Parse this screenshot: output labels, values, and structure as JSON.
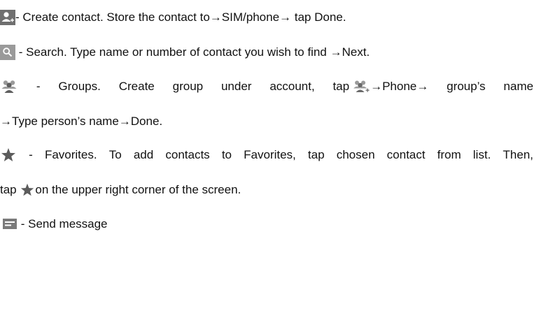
{
  "entries": [
    {
      "icon": "add-contact-icon",
      "text": "- Create contact. Store the contact to→SIM/phone→ tap Done."
    },
    {
      "icon": "search-icon",
      "text": " - Search. Type name or number of contact you wish to find →Next."
    },
    {
      "icon": "groups-icon",
      "text_words": [
        "-",
        "Groups.",
        "Create",
        "group",
        "under",
        "account,",
        "tap"
      ],
      "inline_icon": "add-group-icon",
      "text_after_words": [
        "→Phone→",
        "group’s",
        "name"
      ],
      "continuation": "→Type person’s name→Done."
    },
    {
      "icon": "star-icon",
      "text_words": [
        "-",
        "Favorites.",
        "To",
        "add",
        "contacts",
        "to",
        "Favorites,",
        "tap",
        "chosen",
        "contact",
        "from",
        "list.",
        "Then,"
      ],
      "continuation_before": "tap ",
      "inline_icon": "star-icon",
      "continuation_after": "on the upper right corner of the screen."
    },
    {
      "icon": "message-icon",
      "text": " - Send message"
    }
  ]
}
